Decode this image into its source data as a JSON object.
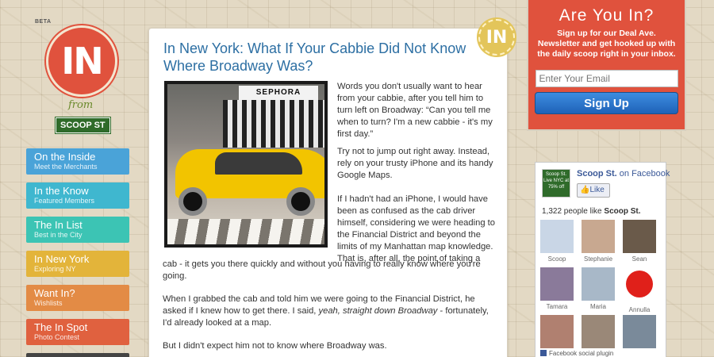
{
  "logo": {
    "beta": "BETA",
    "seal_text": "IN",
    "from": "from",
    "scoop": "SCOOP ST"
  },
  "nav": [
    {
      "title": "On the Inside",
      "subtitle": "Meet the Merchants",
      "color": "#4aa3d8"
    },
    {
      "title": "In the Know",
      "subtitle": "Featured Members",
      "color": "#3fb7cf"
    },
    {
      "title": "The In List",
      "subtitle": "Best in the City",
      "color": "#3cc4b4"
    },
    {
      "title": "In New York",
      "subtitle": "Exploring NY",
      "color": "#e3b43a"
    },
    {
      "title": "Want In?",
      "subtitle": "Wishlists",
      "color": "#e38b45"
    },
    {
      "title": "The In Spot",
      "subtitle": "Photo Contest",
      "color": "#e0613f"
    }
  ],
  "article": {
    "badge": "IN",
    "title": "In New York: What If Your Cabbie Did Not Know Where Broadway Was?",
    "photo_sign": "SEPHORA",
    "p1": "Words you don't usually want to hear from your cabbie, after you tell him to turn left on Broadway: “Can you tell me when to turn? I'm a new cabbie - it's my first day.”",
    "p2": "Try not to jump out right away. Instead, rely on your trusty iPhone and its handy Google Maps.",
    "p3a": "If I hadn't had an iPhone, I would have been as confused as the cab driver himself, considering we were heading to the Financial District and beyond the limits of my Manhattan map knowledge. That is, after all, the point of taking a",
    "p3b": "cab - it gets you there quickly and without you having to really know where you're going.",
    "p4_start": "When I grabbed the cab and told him we were going to the Financial District, he asked if I knew how to get there. I said, ",
    "p4_italic": "yeah, straight down Broadway",
    "p4_end": " - fortunately, I'd already looked at a map.",
    "p5": "But I didn't expect him not to know where Broadway was."
  },
  "signup": {
    "title": "Are You In?",
    "description": "Sign up for our Deal Ave. Newsletter and get hooked up with the daily scoop right in your inbox.",
    "email_placeholder": "Enter Your Email",
    "button": "Sign Up"
  },
  "facebook": {
    "thumb_text": "Scoop St. Live NYC at 75% off",
    "page_name": "Scoop St.",
    "on_facebook": "on Facebook",
    "like_button": "Like",
    "count_text": "1,322 people like",
    "count_page": "Scoop St.",
    "faces": [
      {
        "name": "Scoop",
        "color": "#c9d6e6"
      },
      {
        "name": "Stephanie",
        "color": "#c8a890"
      },
      {
        "name": "Sean",
        "color": "#6a5a4a"
      },
      {
        "name": "Tamara",
        "color": "#8a7a9a"
      },
      {
        "name": "Maria",
        "color": "#a8b8c8"
      },
      {
        "name": "Annulla",
        "color": "#e0201a"
      },
      {
        "name": "",
        "color": "#b08070"
      },
      {
        "name": "",
        "color": "#9a8878"
      },
      {
        "name": "",
        "color": "#7a8a9a"
      }
    ],
    "footer": "Facebook social plugin"
  }
}
